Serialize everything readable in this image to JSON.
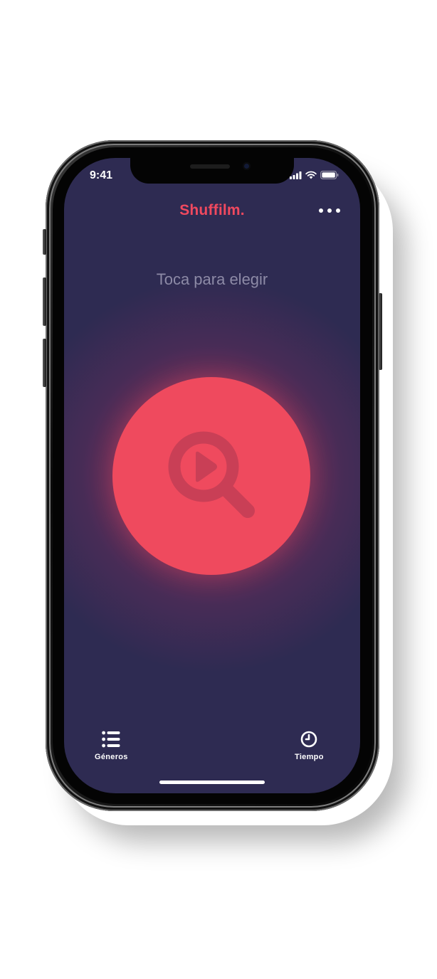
{
  "status_bar": {
    "time": "9:41",
    "icons": [
      "signal-icon",
      "wifi-icon",
      "battery-icon"
    ]
  },
  "header": {
    "title": "Shuffilm.",
    "more_icon": "more-dots-icon"
  },
  "main": {
    "hint": "Toca para elegir",
    "shuffle_icon": "search-play-icon"
  },
  "tab_bar": {
    "genres_label": "Géneros",
    "genres_icon": "list-icon",
    "time_label": "Tiempo",
    "time_icon": "clock-icon"
  },
  "colors": {
    "background": "#2e2b52",
    "accent": "#ef4a5e",
    "hint_text": "#8d8aa6"
  }
}
